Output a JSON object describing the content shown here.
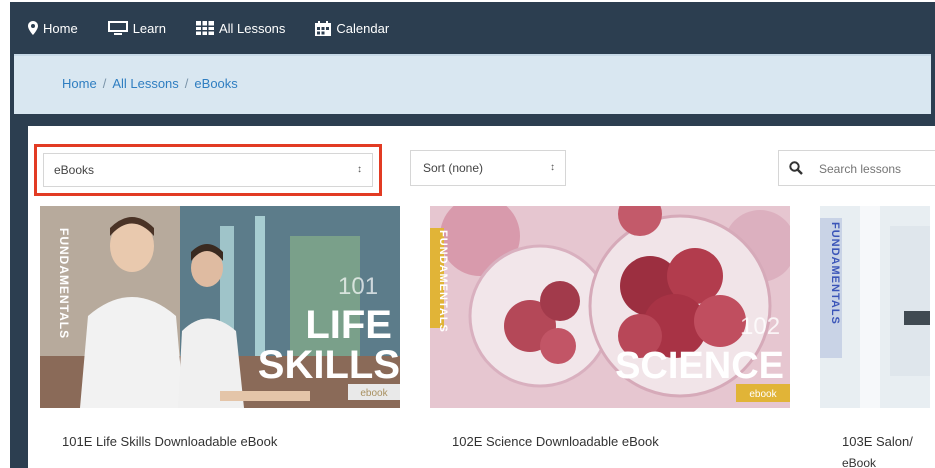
{
  "nav": {
    "items": [
      {
        "label": "Home",
        "icon": "map-marker-icon"
      },
      {
        "label": "Learn",
        "icon": "monitor-icon"
      },
      {
        "label": "All Lessons",
        "icon": "grid-icon"
      },
      {
        "label": "Calendar",
        "icon": "calendar-icon"
      }
    ]
  },
  "breadcrumb": [
    "Home",
    "All Lessons",
    "eBooks"
  ],
  "filters": {
    "category": {
      "selected": "eBooks"
    },
    "sort": {
      "selected": "Sort (none)"
    },
    "search": {
      "placeholder": "Search lessons"
    }
  },
  "cards": [
    {
      "title": "101E Life Skills Downloadable eBook",
      "cover": {
        "series": "FUNDAMENTALS",
        "number": "101",
        "lines": [
          "LIFE",
          "SKILLS"
        ],
        "tag": "ebook"
      }
    },
    {
      "title": "102E Science Downloadable eBook",
      "cover": {
        "series": "FUNDAMENTALS",
        "number": "102",
        "lines": [
          "SCIENCE"
        ],
        "tag": "ebook"
      }
    },
    {
      "title": "103E Salon/",
      "subtitle": "eBook",
      "cover": {
        "series": "FUNDAMENTALS"
      }
    }
  ],
  "colors": {
    "nav_bg": "#2c3e50",
    "breadcrumb_bg": "#d9e7f1",
    "link": "#2f7ec1",
    "highlight_border": "#e23b23"
  }
}
